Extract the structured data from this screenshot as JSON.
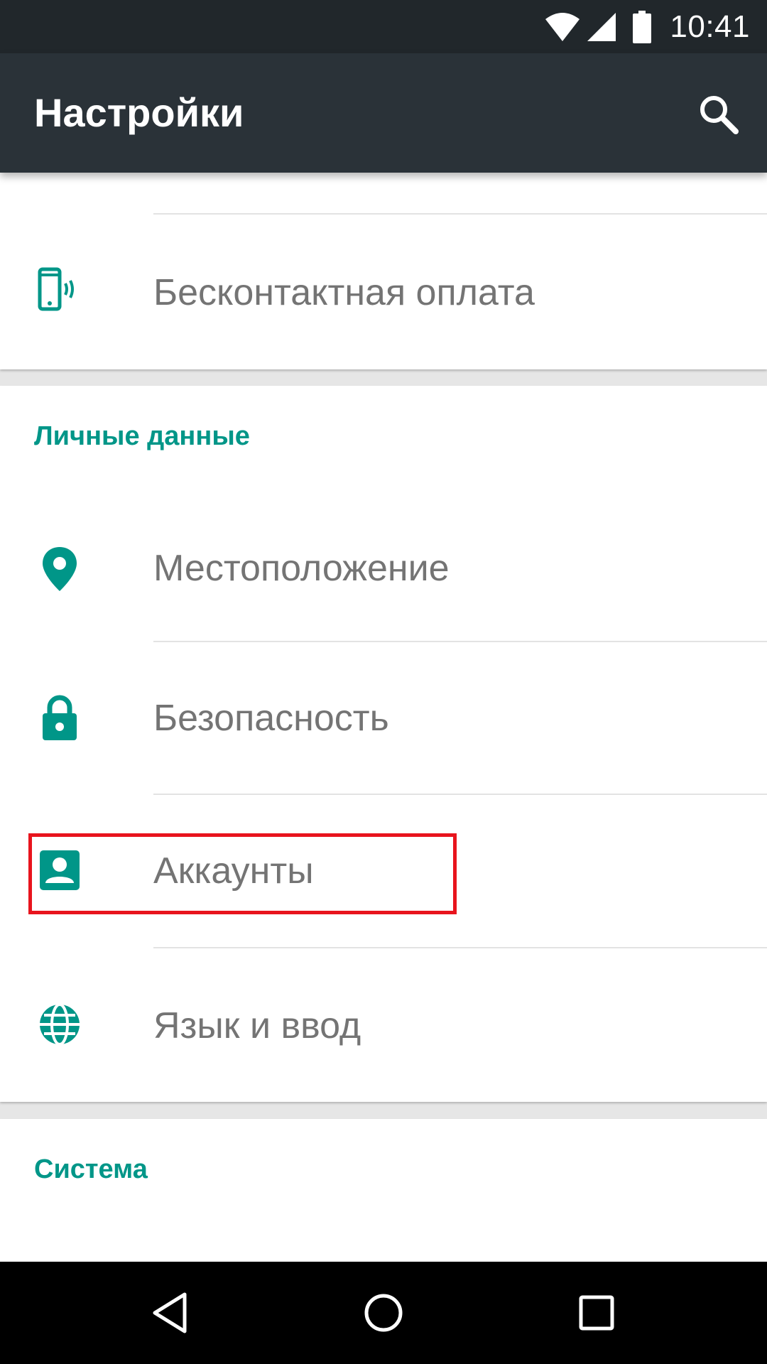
{
  "status_bar": {
    "time": "10:41",
    "icons": [
      "wifi-icon",
      "cellular-signal-icon",
      "battery-icon"
    ]
  },
  "app_bar": {
    "title": "Настройки",
    "search_icon": "search-icon"
  },
  "colors": {
    "accent": "#009688",
    "app_bar": "#2a3238",
    "status_bar": "#21272b",
    "highlight": "#e8141d",
    "item_text": "#747474"
  },
  "top_card": {
    "items": [
      {
        "label": "Бесконтактная оплата",
        "icon": "nfc-payment-icon"
      }
    ]
  },
  "personal_section": {
    "header": "Личные данные",
    "items": [
      {
        "label": "Местоположение",
        "icon": "location-pin-icon"
      },
      {
        "label": "Безопасность",
        "icon": "lock-icon"
      },
      {
        "label": "Аккаунты",
        "icon": "account-icon",
        "highlighted": true
      },
      {
        "label": "Язык и ввод",
        "icon": "globe-icon"
      }
    ]
  },
  "system_section": {
    "header": "Система"
  },
  "nav_bar": {
    "buttons": [
      "back-icon",
      "home-icon",
      "recents-icon"
    ]
  }
}
